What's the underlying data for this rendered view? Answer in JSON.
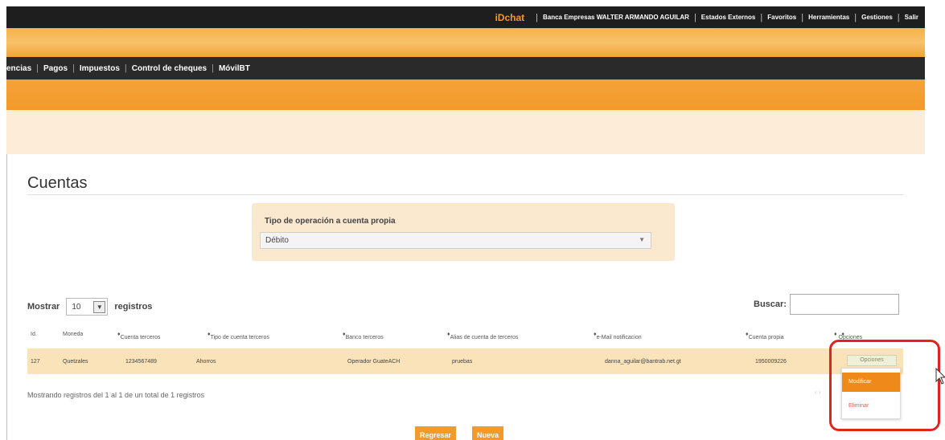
{
  "topbar": {
    "brand": "iDchat",
    "links": [
      "Banca Empresas WALTER ARMANDO AGUILAR",
      "Estados Externos",
      "Favoritos",
      "Herramientas",
      "Gestiones",
      "Salir"
    ]
  },
  "nav": {
    "items": [
      "encias",
      "Pagos",
      "Impuestos",
      "Control de cheques",
      "MóvilBT"
    ]
  },
  "page": {
    "title": "Cuentas"
  },
  "operation": {
    "label": "Tipo de operación a cuenta propia",
    "value": "Débito"
  },
  "table_controls": {
    "show_label": "Mostrar",
    "page_size": "10",
    "records_label": "registros",
    "search_label": "Buscar:"
  },
  "table": {
    "columns": [
      "Id.",
      "Moneda",
      "Cuenta terceros",
      "Tipo de cuenta terceros",
      "Banco terceros",
      "Alias de cuenta de terceros",
      "e-Mail notificacion",
      "Cuenta propia",
      "Opciones"
    ],
    "rows": [
      {
        "id": "127",
        "moneda": "Quetzales",
        "cuenta_terceros": "1234567489",
        "tipo": "Ahorros",
        "banco": "Operador GuateACH",
        "alias": "pruebas",
        "email": "danna_aguilar@bantrab.net.gt",
        "cuenta_propia": "1950009226",
        "opciones": "Opciones"
      }
    ],
    "info": "Mostrando registros del 1 al 1 de un total de 1 registros"
  },
  "options_menu": {
    "items": [
      "Modificar",
      "Eliminar"
    ]
  },
  "buttons": {
    "back": "Regresar",
    "new": "Nueva"
  },
  "colors": {
    "accent": "#f39a2a",
    "highlight": "#e0231e",
    "row": "#fbe3b9"
  }
}
